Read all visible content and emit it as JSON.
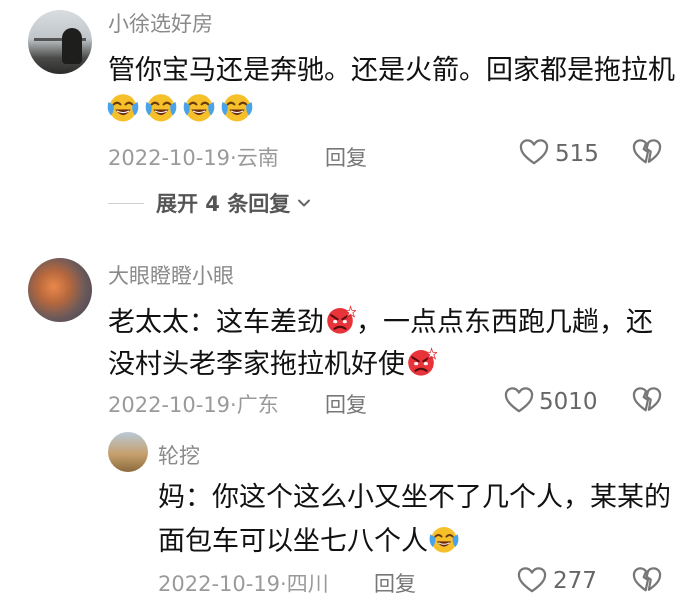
{
  "comments": [
    {
      "username": "小徐选好房",
      "lines": [
        "管你宝马还是奔驰。还是火箭。回家都是拖拉机"
      ],
      "emoji_row": [
        "crying-laughing-icon",
        "crying-laughing-icon",
        "crying-laughing-icon",
        "crying-laughing-icon"
      ],
      "date": "2022-10-19",
      "location": "云南",
      "reply_label": "回复",
      "likes": "515",
      "expand_label": "展开 4 条回复"
    },
    {
      "username": "大眼瞪瞪小眼",
      "line1": "老太太：这车差劲",
      "line1b": "，一点点东西跑几趟，还",
      "line2": "没村头老李家拖拉机好使",
      "date": "2022-10-19",
      "location": "广东",
      "reply_label": "回复",
      "likes": "5010"
    }
  ],
  "replies": [
    {
      "username": "轮挖",
      "line1": "妈：你这个这么小又坐不了几个人，某某的",
      "line2": "面包车可以坐七八个人",
      "date": "2022-10-19",
      "location": "四川",
      "reply_label": "回复",
      "likes": "277"
    }
  ],
  "separator": "·",
  "colors": {
    "text": "#111111",
    "muted": "#9a9a9a",
    "emoji_yellow": "#f6c02b",
    "emoji_tear": "#4aa3e8",
    "emoji_angry": "#e8333a"
  }
}
